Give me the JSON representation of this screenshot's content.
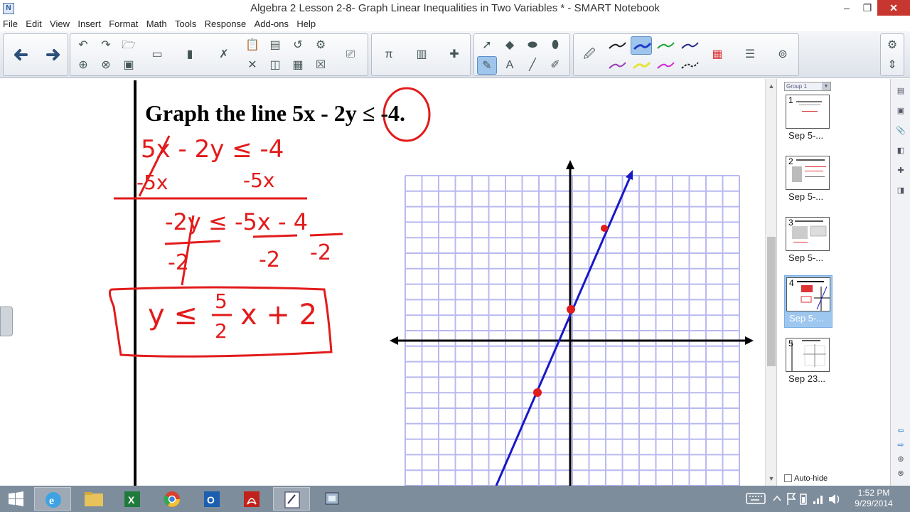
{
  "window": {
    "title": "Algebra 2 Lesson 2-8- Graph Linear Inequalities in Two Variables * - SMART Notebook",
    "app_icon": "smart-notebook-icon",
    "min_glyph": "–",
    "max_glyph": "❐",
    "close_glyph": "✕"
  },
  "menu": [
    "File",
    "Edit",
    "View",
    "Insert",
    "Format",
    "Math",
    "Tools",
    "Response",
    "Add-ons",
    "Help"
  ],
  "page": {
    "heading": "Graph the line 5x - 2y ≤ -4.",
    "handwriting": {
      "line1": "5x - 2y ≤ -4",
      "line2_left": "-5x",
      "line2_right": "-5x",
      "line3": "-2y ≤ -5x - 4",
      "line4_a": "-2",
      "line4_b": "-2",
      "line4_c": "-2",
      "result_lhs": "y ≤",
      "result_num": "5",
      "result_den": "2",
      "result_rhs": "x + 2"
    },
    "colors": {
      "ink_red": "#e21b1b",
      "line_blue": "#1818c8",
      "grid": "#b9b9f0"
    }
  },
  "sorter": {
    "group_label": "Group 1",
    "pages": [
      {
        "num": "1",
        "label": "Sep 5-..."
      },
      {
        "num": "2",
        "label": "Sep 5-..."
      },
      {
        "num": "3",
        "label": "Sep 5-..."
      },
      {
        "num": "4",
        "label": "Sep 5-..."
      },
      {
        "num": "5",
        "label": "Sep 23..."
      }
    ],
    "selected_index": 3,
    "auto_hide_label": "Auto-hide"
  },
  "taskbar": {
    "time": "1:52 PM",
    "date": "9/29/2014"
  }
}
